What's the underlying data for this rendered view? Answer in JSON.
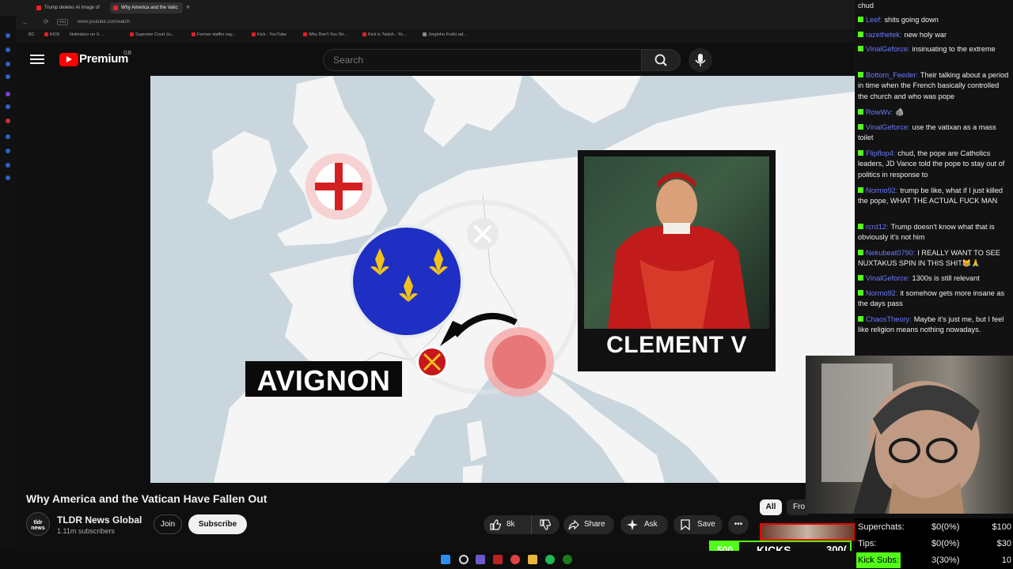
{
  "browser": {
    "tabs": [
      {
        "label": "Trump deletes AI image of",
        "active": false
      },
      {
        "label": "Why America and the Vatic",
        "active": true
      }
    ],
    "url": "www.youtube.com/watch",
    "bookmarks": [
      "BC",
      "KICK",
      "Nolimitzor on X: ...",
      "Supreme Court Ju...",
      "Former staffer say...",
      "Kick - YouTube",
      "Why Don't You Str...",
      "Kick is Twitch - Yo...",
      "Jorginho Frello ad..."
    ]
  },
  "youtube": {
    "premium_label": "Premium",
    "region": "GB",
    "search_placeholder": "Search"
  },
  "video": {
    "map_label": "AVIGNON",
    "portrait_caption": "CLEMENT V"
  },
  "details": {
    "title": "Why America and the Vatican Have Fallen Out",
    "channel": "TLDR News Global",
    "channel_avatar_text": "tldr news",
    "subscribers": "1.11m subscribers",
    "join": "Join",
    "subscribe": "Subscribe",
    "likes": "8k",
    "share": "Share",
    "ask": "Ask",
    "save": "Save",
    "more": "•••",
    "chip_all": "All",
    "chip_from": "Fro"
  },
  "chat": {
    "messages": [
      {
        "user": "",
        "text": "chud"
      },
      {
        "user": "Leef:",
        "text": "shits going down"
      },
      {
        "user": "razethetek:",
        "text": "new holy war"
      },
      {
        "user": "VinalGeforce:",
        "text": "insinuating to the extreme"
      },
      {
        "user": "Bottom_Feeder:",
        "text": "Their talking about a period in time when the French basically controlled the church and who was pope"
      },
      {
        "user": "RowWv:",
        "text": "🪨"
      },
      {
        "user": "VinalGeforce:",
        "text": "use the vatixan as a mass toilet"
      },
      {
        "user": "Flipflop4:",
        "text": "chud, the pope are Catholics leaders, JD Vance told the pope to stay out of politics in response to"
      },
      {
        "user": "Normo92:",
        "text": "trump be like, what if I just killed the pope, WHAT THE ACTUAL FUCK MAN"
      },
      {
        "user": "rcrd12:",
        "text": "Trump doesn't know what that is obviously it's not him"
      },
      {
        "user": "Nekubeat0790:",
        "text": "I REALLY WANT TO SEE NUXTAKUS SPIN IN THIS SHIT😹🙏"
      },
      {
        "user": "VinalGeforce:",
        "text": "1300s is still relevant"
      },
      {
        "user": "Normo92:",
        "text": "it somehow gets more insane as the days pass"
      },
      {
        "user": "ChaosTheory:",
        "text": "Maybe it's just me, but I feel like religion means nothing nowadays."
      }
    ]
  },
  "stats": {
    "rows": [
      {
        "label": "Superchats:",
        "value": "$0(0%)",
        "target": "$100"
      },
      {
        "label": "Tips:",
        "value": "$0(0%)",
        "target": "$30"
      },
      {
        "label": "Kick Subs:",
        "value": "3(30%)",
        "target": "10"
      }
    ]
  },
  "kicks_goal": {
    "current": "500",
    "label": "KICKS",
    "target": "300("
  },
  "colors": {
    "kick_green": "#53fc18",
    "yt_red": "#ff0000",
    "map_sea": "#c9d6dd",
    "map_land": "#f4f5f4",
    "france_blue": "#1f2fc4",
    "fleur_gold": "#f2c21b"
  }
}
